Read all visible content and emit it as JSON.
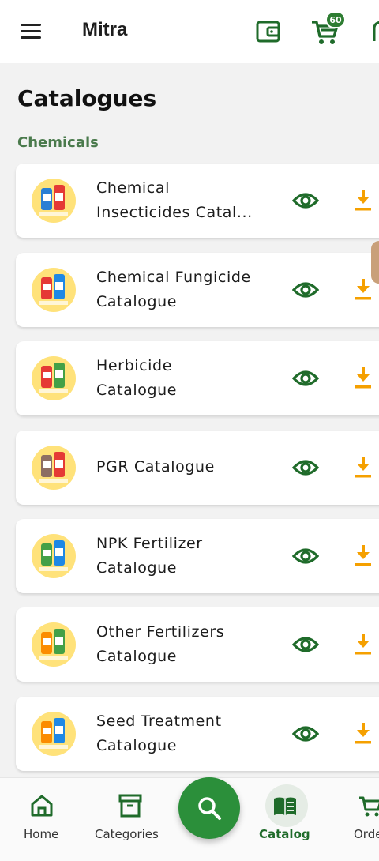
{
  "app_bar": {
    "title": "Mitra",
    "cart_badge": "60",
    "icons": [
      "menu-icon",
      "wallet-icon",
      "cart-icon",
      "notification-icon"
    ]
  },
  "page_title": "Catalogues",
  "section_title": "Chemicals",
  "catalogues": [
    {
      "line1": "Chemical",
      "line2": "Insecticides Catal..."
    },
    {
      "line1": "Chemical Fungicide",
      "line2": "Catalogue"
    },
    {
      "line1": "Herbicide",
      "line2": "Catalogue"
    },
    {
      "line1": "PGR Catalogue",
      "line2": ""
    },
    {
      "line1": "NPK Fertilizer",
      "line2": "Catalogue"
    },
    {
      "line1": "Other Fertilizers",
      "line2": "Catalogue"
    },
    {
      "line1": "Seed Treatment",
      "line2": "Catalogue"
    }
  ],
  "bottom_nav": {
    "home": "Home",
    "categories": "Categories",
    "catalog": "Catalog",
    "orders": "Orders"
  },
  "colors": {
    "primary_green": "#1f6b2a",
    "fab_green": "#2b8f3a",
    "download_orange": "#f5a000",
    "section_green": "#4a7a4c"
  }
}
